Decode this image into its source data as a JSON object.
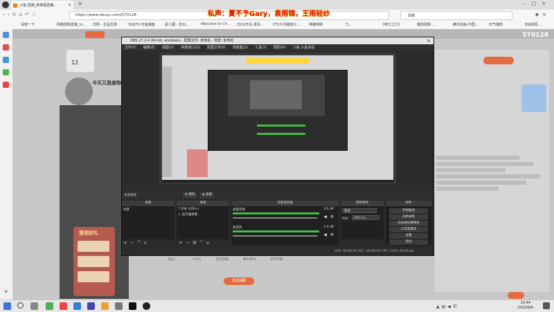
{
  "browser": {
    "tab_title": "斗鱼-直播_新旅程直播...",
    "url": "https://www.douyu.com/570128",
    "search_label": "百度",
    "bookmarks": [
      "百度一下",
      "网络舒服直播_tv...",
      "优购 - 正品优惠",
      "好运TV-天金播客",
      "素人圈 - 爱出...",
      "Welcome to Ch...",
      "ZD大作业-更多...",
      "iiTV大书播放众...",
      "神魔特碗",
      "飞...",
      "《神工之力》",
      "猫狗视频...",
      "腾讯动画-中国...",
      "天气播放",
      "B站视频..."
    ]
  },
  "room": {
    "id": "570128",
    "count": "12",
    "streamer_title": "今天又是废物",
    "marquee": "私声：夏不予Gary，袁雨锦，王雨轻纱"
  },
  "obs": {
    "title": "OBS 27.2.4 (64-bit, windows) - 配置文件: 未命名 - 场景: 未命名",
    "menu": [
      "文件(F)",
      "编辑(E)",
      "视图(V)",
      "停靠窗口(D)",
      "配置文件(P)",
      "场景集(S)",
      "工具(T)",
      "帮助(H)",
      "斗鱼-斗鱼多码"
    ],
    "no_source": "未选择源",
    "props_btn": "属性",
    "filters_btn": "滤镜",
    "scenes_header": "场景",
    "scenes": [
      "场景"
    ],
    "sources_header": "来源",
    "sources": [
      "文本 (GDI+)",
      "显示器采集"
    ],
    "mixer_header": "音频混音器",
    "mixer": [
      {
        "name": "桌面音频",
        "level": "0.0 dB"
      },
      {
        "name": "麦克风",
        "level": "0.0 dB"
      }
    ],
    "transitions_header": "转场特效",
    "transition_value": "渐变",
    "duration_label": "时长",
    "duration_value": "300 ms",
    "controls_header": "控件",
    "controls": [
      "开始推流",
      "开始录制",
      "启动虚拟摄像机",
      "工作室模式",
      "设置",
      "退出"
    ],
    "status": "LIVE: 00:00:00   REC: 00:00:00   CPU: 3.6%, 60.00 fps"
  },
  "page_bottom": {
    "gift_title": "签到好礼",
    "chat_button": "发送弹幕",
    "stats": [
      "粉丝：",
      "CDE5",
      "开启直播",
      "精彩瞬间",
      "贵宾专属"
    ]
  },
  "taskbar": {
    "time": "13:44",
    "date": "2022/6/6"
  },
  "colors": {
    "accent": "#e56b42",
    "obs_bg": "#2b2b2b",
    "meter_green": "#3fbf3f"
  }
}
